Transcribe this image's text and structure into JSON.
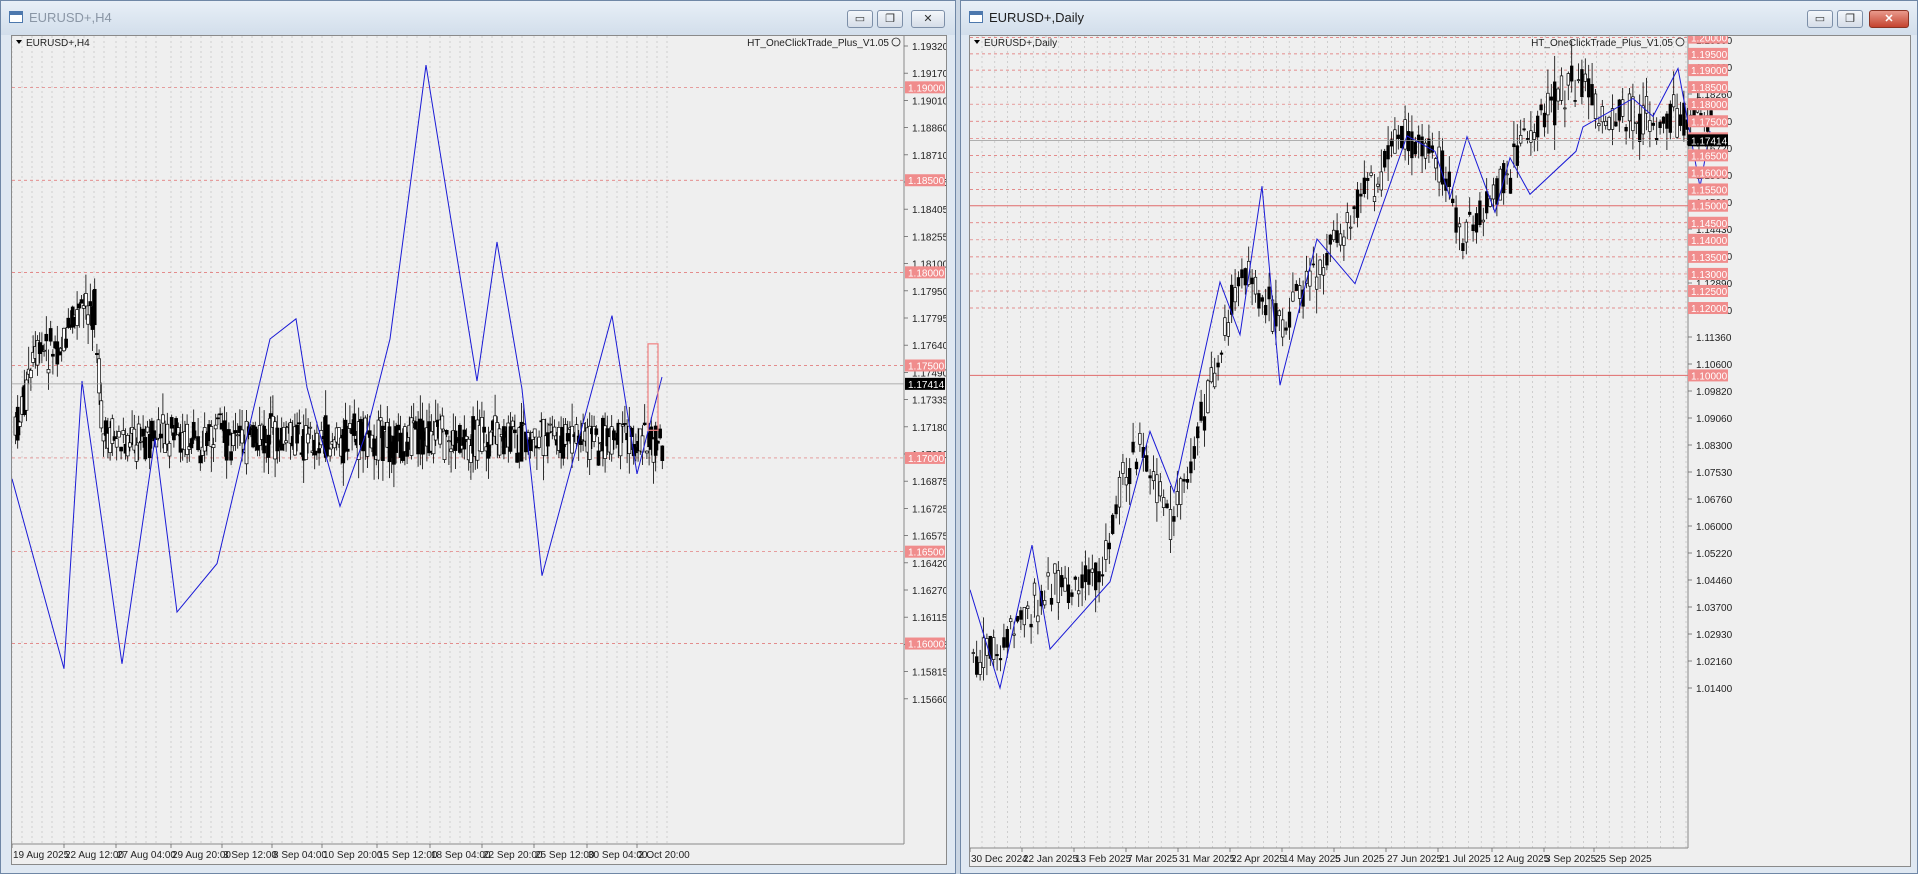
{
  "windows": [
    {
      "id": "w1",
      "title": "EURUSD+,H4",
      "chart_label": "EURUSD+,H4",
      "indicator": "HT_OneClickTrade_Plus_V1.05",
      "price_axis": [
        "1.19320",
        "1.19170",
        "1.19010",
        "1.18860",
        "1.18710",
        "1.18555",
        "1.18405",
        "1.18255",
        "1.18100",
        "1.17950",
        "1.17795",
        "1.17640",
        "1.17490",
        "1.17335",
        "1.17180",
        "1.17030",
        "1.16875",
        "1.16725",
        "1.16575",
        "1.16420",
        "1.16270",
        "1.16115",
        "1.15965",
        "1.15815",
        "1.15660"
      ],
      "level_tags": [
        "1.19000",
        "1.18500",
        "1.18000",
        "1.17500",
        "1.17000",
        "1.16500",
        "1.16000"
      ],
      "current_price": "1.17414",
      "time_axis": [
        "19 Aug 2025",
        "22 Aug 12:00",
        "27 Aug 04:00",
        "29 Aug 20:00",
        "3 Sep 12:00",
        "8 Sep 04:00",
        "10 Sep 20:00",
        "15 Sep 12:00",
        "18 Sep 04:00",
        "22 Sep 20:00",
        "25 Sep 12:00",
        "30 Sep 04:00",
        "2 Oct 20:00"
      ]
    },
    {
      "id": "w2",
      "title": "EURUSD+,Daily",
      "chart_label": "EURUSD+,Daily",
      "indicator": "HT_OneClickTrade_Plus_V1.05",
      "price_axis": [
        "1.19800",
        "1.19030",
        "1.18260",
        "1.17490",
        "1.16720",
        "1.15960",
        "1.15200",
        "1.14430",
        "1.13660",
        "1.12890",
        "1.12130",
        "1.11360",
        "1.10600",
        "1.09820",
        "1.09060",
        "1.08300",
        "1.07530",
        "1.06760",
        "1.06000",
        "1.05220",
        "1.04460",
        "1.03700",
        "1.02930",
        "1.02160",
        "1.01400"
      ],
      "level_tags": [
        "1.20000",
        "1.19500",
        "1.19000",
        "1.18500",
        "1.18000",
        "1.17500",
        "1.17000",
        "1.16500",
        "1.16000",
        "1.15500",
        "1.15000",
        "1.14500",
        "1.14000",
        "1.13500",
        "1.13000",
        "1.12500",
        "1.12000",
        "1.10000"
      ],
      "current_price": "1.17414",
      "time_axis": [
        "30 Dec 2024",
        "22 Jan 2025",
        "13 Feb 2025",
        "7 Mar 2025",
        "31 Mar 2025",
        "22 Apr 2025",
        "14 May 2025",
        "5 Jun 2025",
        "27 Jun 2025",
        "21 Jul 2025",
        "12 Aug 2025",
        "3 Sep 2025",
        "25 Sep 2025"
      ]
    }
  ],
  "buttons": {
    "minimize": "▭",
    "restore": "❐",
    "close": "✕"
  },
  "colors": {
    "candle": "#000000",
    "zigzag": "#1a1ad6",
    "level_line": "#e06c6c",
    "level_tag": "#f08c8c",
    "grid": "#b9b9b9",
    "chart_bg": "#efefef"
  }
}
